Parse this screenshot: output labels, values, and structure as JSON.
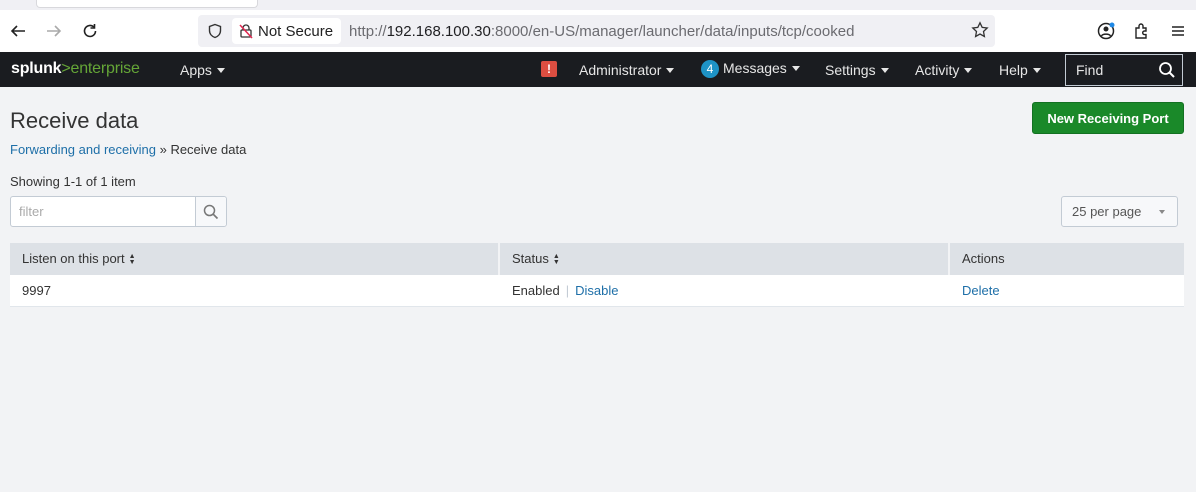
{
  "browser": {
    "not_secure_label": "Not Secure",
    "url_prefix": "http://",
    "url_host": "192.168.100.30",
    "url_rest": ":8000/en-US/manager/launcher/data/inputs/tcp/cooked"
  },
  "splunk_nav": {
    "logo_brand": "splunk",
    "logo_gt": ">",
    "logo_product": "enterprise",
    "apps_label": "Apps",
    "admin_label": "Administrator",
    "messages_count": "4",
    "messages_label": "Messages",
    "settings_label": "Settings",
    "activity_label": "Activity",
    "help_label": "Help",
    "find_placeholder": "Find",
    "alert_glyph": "!"
  },
  "page": {
    "title": "Receive data",
    "breadcrumb_parent": "Forwarding and receiving",
    "breadcrumb_sep": " » ",
    "breadcrumb_current": "Receive data",
    "new_button_label": "New Receiving Port",
    "showing_text": "Showing 1-1 of 1 item",
    "filter_placeholder": "filter",
    "per_page_label": "25 per page"
  },
  "table": {
    "columns": [
      "Listen on this port",
      "Status",
      "Actions"
    ],
    "rows": [
      {
        "port": "9997",
        "status": "Enabled",
        "toggle_action": "Disable",
        "delete_action": "Delete"
      }
    ]
  },
  "colors": {
    "primary_button": "#1a8929",
    "link": "#1e6fa8",
    "nav_bg": "#1a1c20",
    "brand_green": "#65a637",
    "alert_red": "#dc4e41",
    "badge_blue": "#1e93c6"
  }
}
